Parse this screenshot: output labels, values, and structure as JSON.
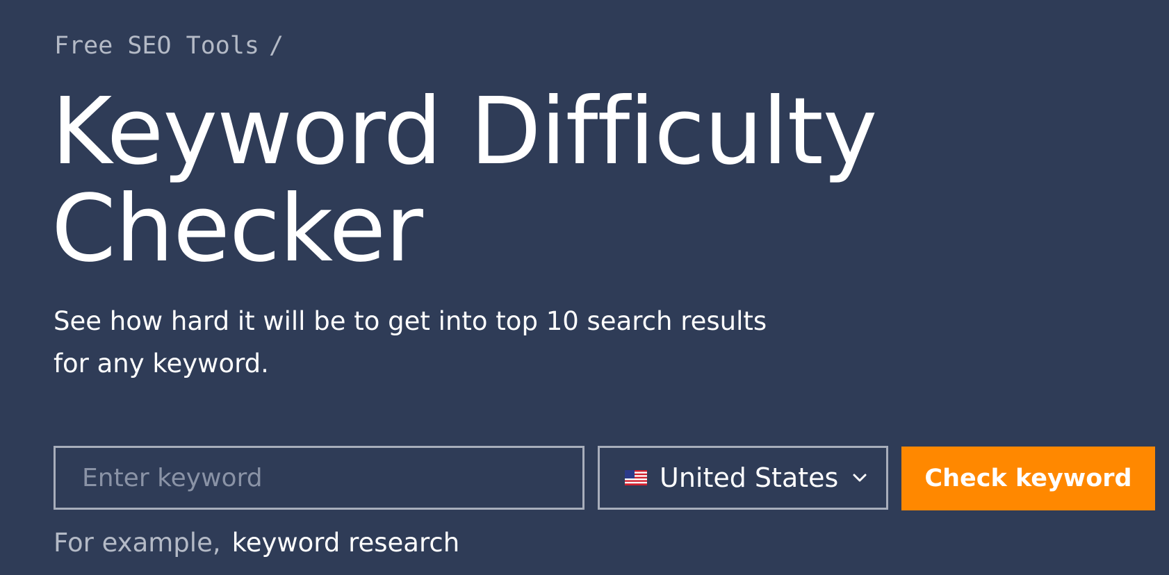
{
  "breadcrumb": {
    "parent": "Free SEO Tools",
    "separator": "/"
  },
  "title": {
    "line1": "Keyword Difficulty",
    "line2": "Checker"
  },
  "subtitle": {
    "line1": "See how hard it will be to get into top 10 search results",
    "line2": "for any keyword."
  },
  "search": {
    "placeholder": "Enter keyword",
    "value": ""
  },
  "country": {
    "selected": "United States",
    "flag_icon": "us-flag-icon",
    "dropdown_icon": "chevron-down-icon"
  },
  "submit": {
    "label": "Check keyword"
  },
  "example": {
    "label": "For example,",
    "keyword": "keyword research"
  },
  "colors": {
    "background": "#2f3c57",
    "accent": "#ff8800",
    "muted_text": "#b4bac6",
    "border": "#a8aebb"
  }
}
